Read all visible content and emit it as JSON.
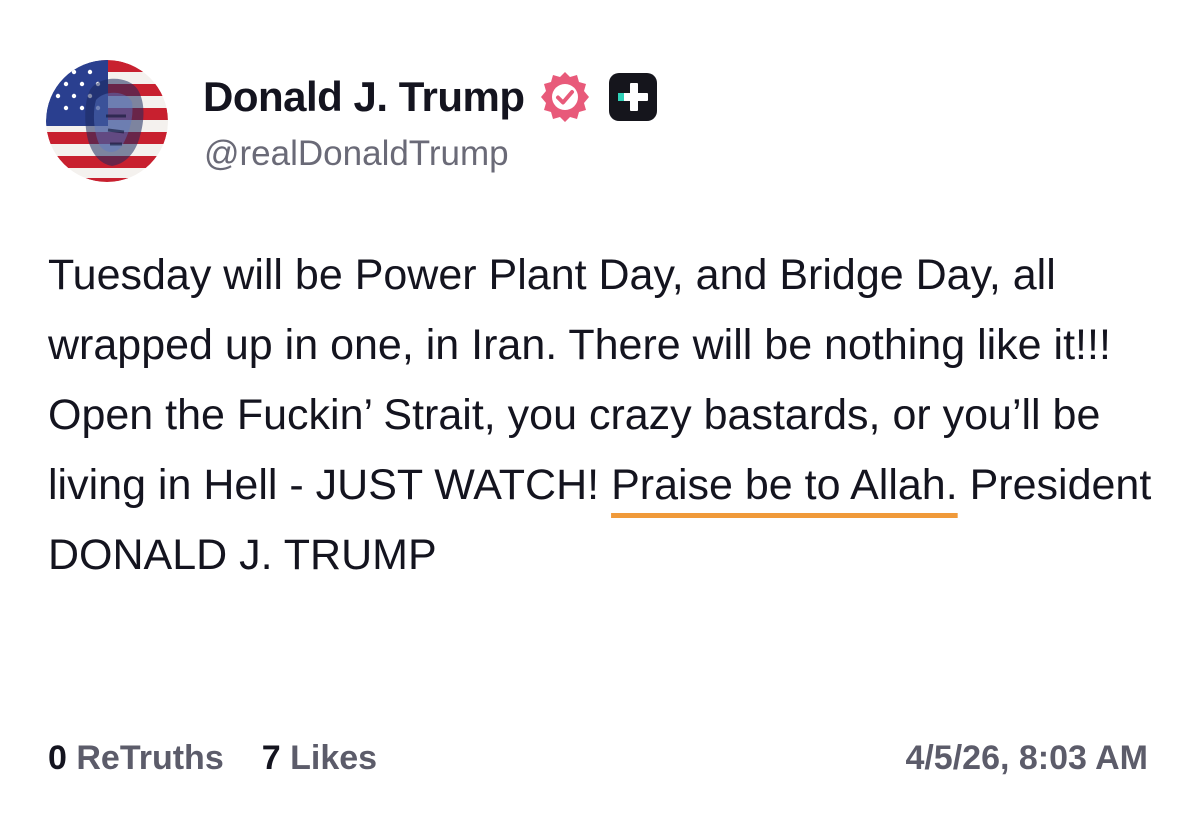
{
  "author": {
    "display_name": "Donald J. Trump",
    "handle": "@realDonaldTrump",
    "avatar_icon": "american-flag-portrait-avatar",
    "verified_icon": "verified-check-badge-icon",
    "verified_color": "#e85a7a",
    "plus_icon": "plus-badge-icon"
  },
  "post": {
    "text_before": "Tuesday will be Power Plant Day, and Bridge Day, all wrapped up in one, in Iran. There will be nothing like it!!! Open the Fuckin’ Strait, you crazy bastards, or you’ll be living in Hell - JUST WATCH! ",
    "text_highlight": "Praise be to Allah.",
    "text_after": " President DONALD J. TRUMP",
    "highlight_color": "#f09a3a"
  },
  "stats": {
    "retruths_count": "0",
    "retruths_label": "ReTruths",
    "likes_count": "7",
    "likes_label": "Likes"
  },
  "timestamp": "4/5/26, 8:03 AM"
}
